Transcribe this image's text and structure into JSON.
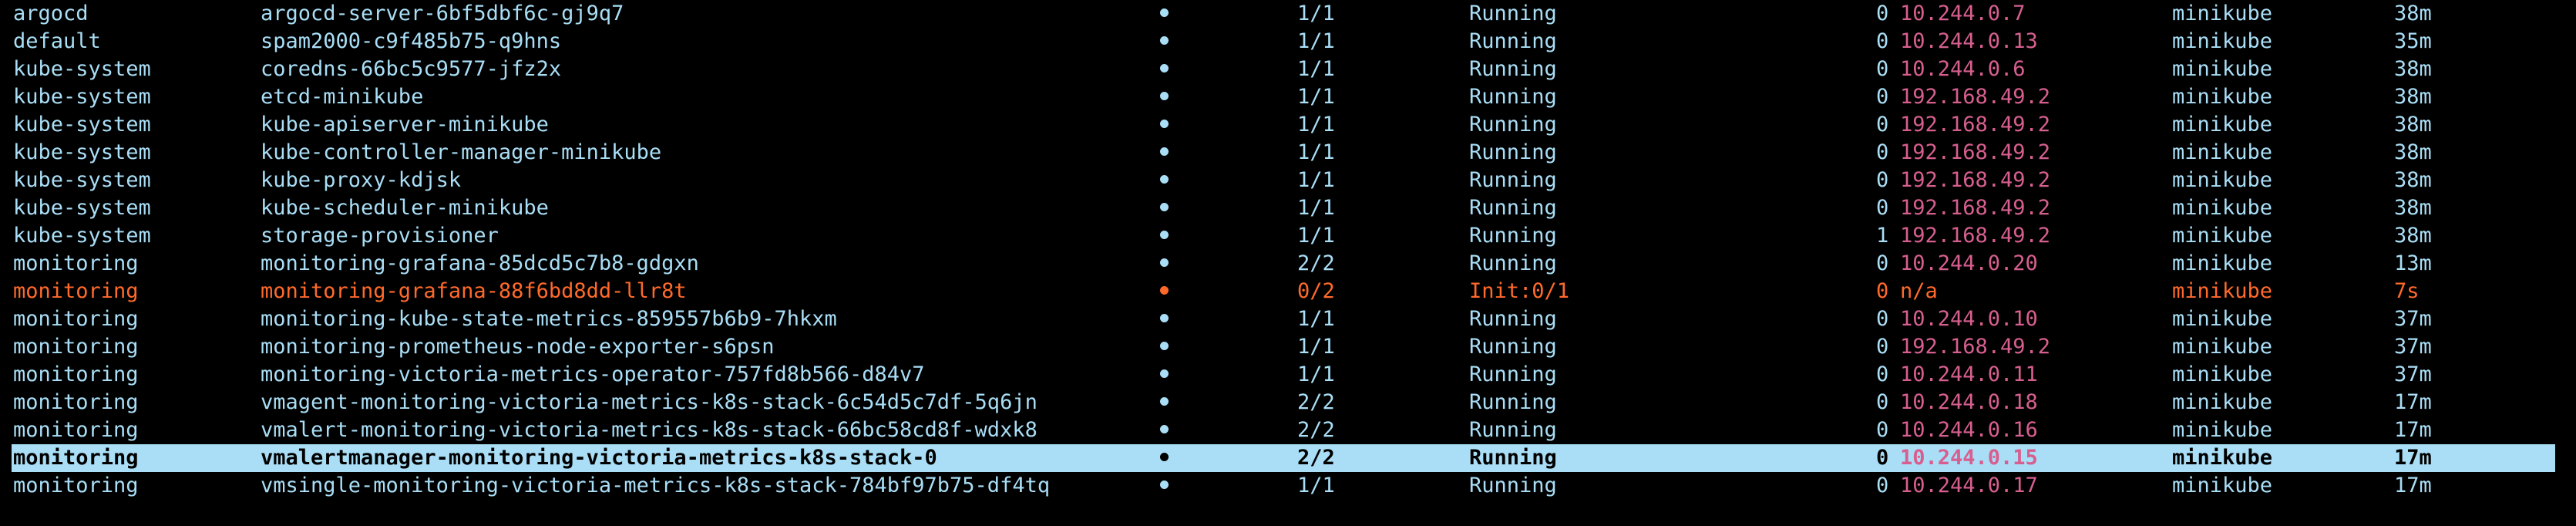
{
  "colors": {
    "background": "#000000",
    "text": "#a9def6",
    "ip": "#d75f8f",
    "pending": "#ff6a2b",
    "selection_bg": "#a9def6"
  },
  "status_icon": "filled-circle",
  "pods": [
    {
      "namespace": "argocd",
      "name": "argocd-server-6bf5dbf6c-gj9q7",
      "ready": "1/1",
      "status": "Running",
      "restarts": "0",
      "ip": "10.244.0.7",
      "node": "minikube",
      "age": "38m",
      "state": "normal"
    },
    {
      "namespace": "default",
      "name": "spam2000-c9f485b75-q9hns",
      "ready": "1/1",
      "status": "Running",
      "restarts": "0",
      "ip": "10.244.0.13",
      "node": "minikube",
      "age": "35m",
      "state": "normal"
    },
    {
      "namespace": "kube-system",
      "name": "coredns-66bc5c9577-jfz2x",
      "ready": "1/1",
      "status": "Running",
      "restarts": "0",
      "ip": "10.244.0.6",
      "node": "minikube",
      "age": "38m",
      "state": "normal"
    },
    {
      "namespace": "kube-system",
      "name": "etcd-minikube",
      "ready": "1/1",
      "status": "Running",
      "restarts": "0",
      "ip": "192.168.49.2",
      "node": "minikube",
      "age": "38m",
      "state": "normal"
    },
    {
      "namespace": "kube-system",
      "name": "kube-apiserver-minikube",
      "ready": "1/1",
      "status": "Running",
      "restarts": "0",
      "ip": "192.168.49.2",
      "node": "minikube",
      "age": "38m",
      "state": "normal"
    },
    {
      "namespace": "kube-system",
      "name": "kube-controller-manager-minikube",
      "ready": "1/1",
      "status": "Running",
      "restarts": "0",
      "ip": "192.168.49.2",
      "node": "minikube",
      "age": "38m",
      "state": "normal"
    },
    {
      "namespace": "kube-system",
      "name": "kube-proxy-kdjsk",
      "ready": "1/1",
      "status": "Running",
      "restarts": "0",
      "ip": "192.168.49.2",
      "node": "minikube",
      "age": "38m",
      "state": "normal"
    },
    {
      "namespace": "kube-system",
      "name": "kube-scheduler-minikube",
      "ready": "1/1",
      "status": "Running",
      "restarts": "0",
      "ip": "192.168.49.2",
      "node": "minikube",
      "age": "38m",
      "state": "normal"
    },
    {
      "namespace": "kube-system",
      "name": "storage-provisioner",
      "ready": "1/1",
      "status": "Running",
      "restarts": "1",
      "ip": "192.168.49.2",
      "node": "minikube",
      "age": "38m",
      "state": "normal"
    },
    {
      "namespace": "monitoring",
      "name": "monitoring-grafana-85dcd5c7b8-gdgxn",
      "ready": "2/2",
      "status": "Running",
      "restarts": "0",
      "ip": "10.244.0.20",
      "node": "minikube",
      "age": "13m",
      "state": "normal"
    },
    {
      "namespace": "monitoring",
      "name": "monitoring-grafana-88f6bd8dd-llr8t",
      "ready": "0/2",
      "status": "Init:0/1",
      "restarts": "0",
      "ip": "n/a",
      "node": "minikube",
      "age": "7s",
      "state": "pending"
    },
    {
      "namespace": "monitoring",
      "name": "monitoring-kube-state-metrics-859557b6b9-7hkxm",
      "ready": "1/1",
      "status": "Running",
      "restarts": "0",
      "ip": "10.244.0.10",
      "node": "minikube",
      "age": "37m",
      "state": "normal"
    },
    {
      "namespace": "monitoring",
      "name": "monitoring-prometheus-node-exporter-s6psn",
      "ready": "1/1",
      "status": "Running",
      "restarts": "0",
      "ip": "192.168.49.2",
      "node": "minikube",
      "age": "37m",
      "state": "normal"
    },
    {
      "namespace": "monitoring",
      "name": "monitoring-victoria-metrics-operator-757fd8b566-d84v7",
      "ready": "1/1",
      "status": "Running",
      "restarts": "0",
      "ip": "10.244.0.11",
      "node": "minikube",
      "age": "37m",
      "state": "normal"
    },
    {
      "namespace": "monitoring",
      "name": "vmagent-monitoring-victoria-metrics-k8s-stack-6c54d5c7df-5q6jn",
      "ready": "2/2",
      "status": "Running",
      "restarts": "0",
      "ip": "10.244.0.18",
      "node": "minikube",
      "age": "17m",
      "state": "normal"
    },
    {
      "namespace": "monitoring",
      "name": "vmalert-monitoring-victoria-metrics-k8s-stack-66bc58cd8f-wdxk8",
      "ready": "2/2",
      "status": "Running",
      "restarts": "0",
      "ip": "10.244.0.16",
      "node": "minikube",
      "age": "17m",
      "state": "normal"
    },
    {
      "namespace": "monitoring",
      "name": "vmalertmanager-monitoring-victoria-metrics-k8s-stack-0",
      "ready": "2/2",
      "status": "Running",
      "restarts": "0",
      "ip": "10.244.0.15",
      "node": "minikube",
      "age": "17m",
      "state": "selected"
    },
    {
      "namespace": "monitoring",
      "name": "vmsingle-monitoring-victoria-metrics-k8s-stack-784bf97b75-df4tq",
      "ready": "1/1",
      "status": "Running",
      "restarts": "0",
      "ip": "10.244.0.17",
      "node": "minikube",
      "age": "17m",
      "state": "normal"
    }
  ]
}
